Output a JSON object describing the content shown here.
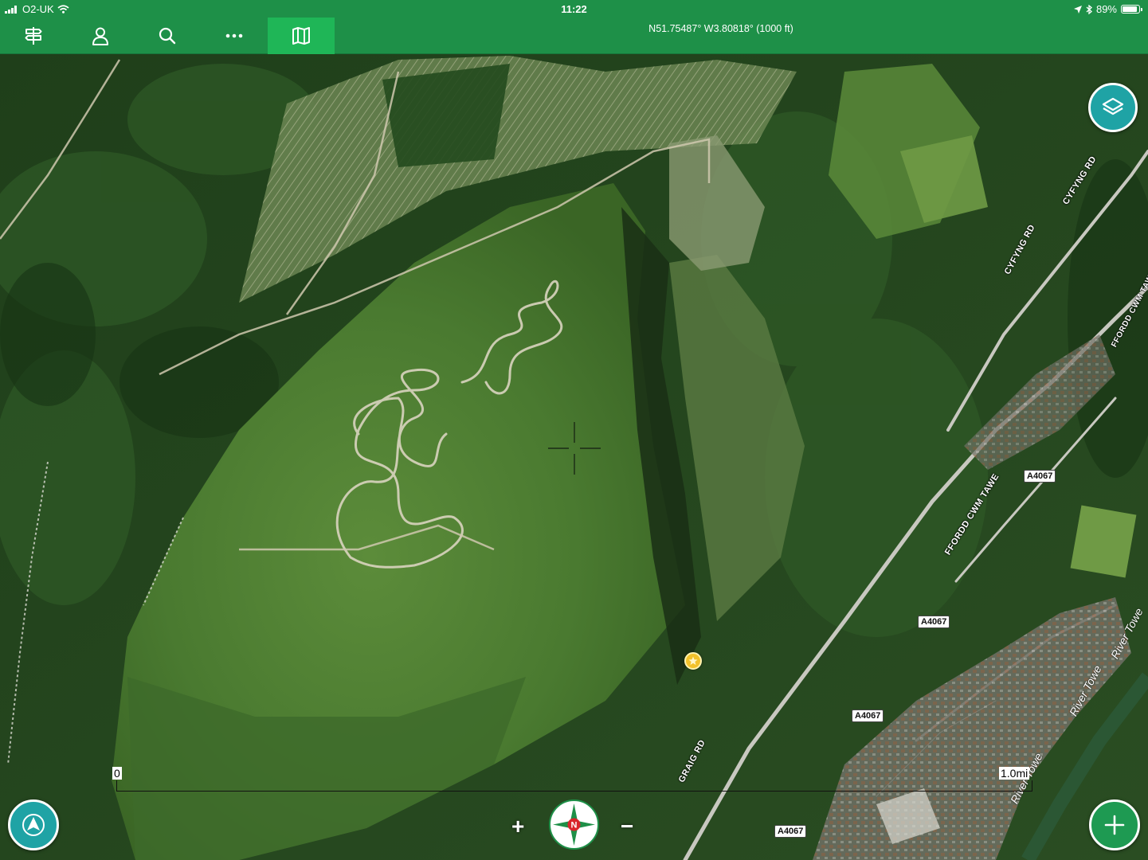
{
  "status": {
    "carrier": "O2-UK",
    "time": "11:22",
    "battery": "89%",
    "battery_level": 0.89
  },
  "toolbar": {
    "items": [
      {
        "icon": "route-signpost-icon",
        "active": false
      },
      {
        "icon": "profile-icon",
        "active": false
      },
      {
        "icon": "search-icon",
        "active": false
      },
      {
        "icon": "more-icon",
        "active": false
      },
      {
        "icon": "map-icon",
        "active": true
      }
    ],
    "coordinates": "N51.75487° W3.80818°  (1000 ft)"
  },
  "map": {
    "road_labels": [
      "A4067",
      "A4067",
      "A4067",
      "A4067"
    ],
    "street_labels": [
      "CYFYNG RD",
      "CYFYNG RD",
      "FFORDD CWM TAWE",
      "FFORDD CWM TAWE",
      "GRAIG RD"
    ],
    "river_labels": [
      "River Towe",
      "River Towe",
      "River Towe"
    ],
    "scale": {
      "start": "0",
      "end": "1.0mi"
    },
    "waypoint_icon": "star-icon"
  },
  "controls": {
    "layers_icon": "layers-icon",
    "locate_icon": "navigation-arrow-icon",
    "add_icon": "plus-icon",
    "zoom_in": "+",
    "zoom_out": "−",
    "compass_label": "N"
  },
  "colors": {
    "topbar": "#1e9048",
    "active_tab": "#1fb657",
    "teal_button": "#1fa3a5",
    "add_button": "#1e9a52",
    "waypoint": "#f2c22b"
  }
}
